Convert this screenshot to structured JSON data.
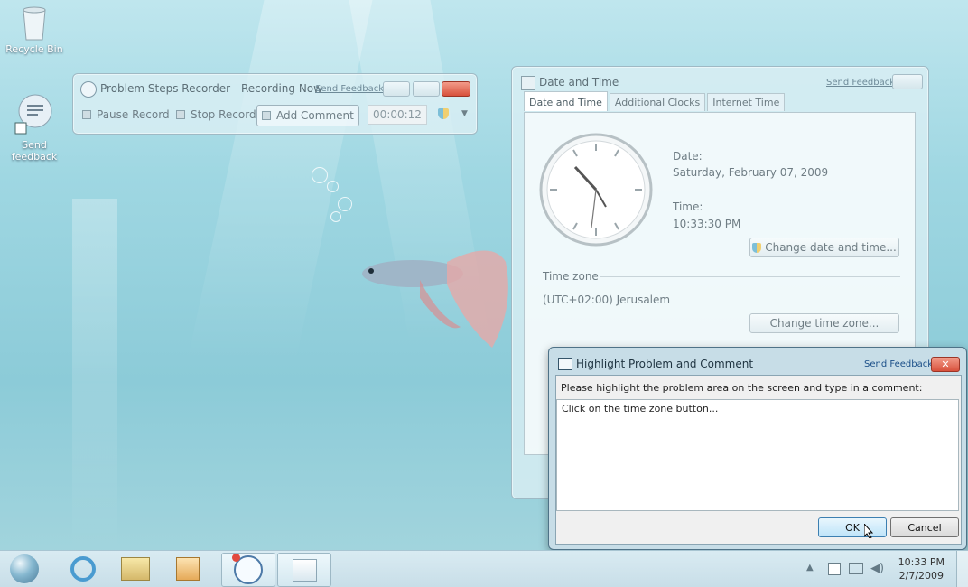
{
  "desktop": {
    "icons": [
      {
        "label": "Recycle Bin",
        "icon": "recycle-bin-icon"
      },
      {
        "label": "Send feedback",
        "icon": "send-feedback-icon"
      }
    ]
  },
  "psr": {
    "title": "Problem Steps Recorder - Recording Now",
    "send_feedback": "Send Feedback",
    "pause": "Pause Record",
    "stop": "Stop Record",
    "add_comment": "Add Comment",
    "timer": "00:00:12"
  },
  "datetime": {
    "title": "Date and Time",
    "send_feedback": "Send Feedback",
    "tabs": [
      "Date and Time",
      "Additional Clocks",
      "Internet Time"
    ],
    "date_label": "Date:",
    "date_value": "Saturday, February 07, 2009",
    "time_label": "Time:",
    "time_value": "10:33:30 PM",
    "change_date_button": "Change date and time...",
    "timezone_header": "Time zone",
    "timezone_value": "(UTC+02:00) Jerusalem",
    "change_timezone_button": "Change time zone..."
  },
  "dialog": {
    "title": "Highlight Problem and Comment",
    "send_feedback": "Send Feedback",
    "prompt": "Please highlight the problem area on the screen and type in a comment:",
    "comment": "Click on the time zone button...",
    "ok": "OK",
    "cancel": "Cancel"
  },
  "taskbar": {
    "time": "10:33 PM",
    "date": "2/7/2009",
    "items": [
      "start-orb-icon",
      "internet-explorer-icon",
      "explorer-icon",
      "media-player-icon",
      "problem-steps-recorder-icon",
      "date-time-icon"
    ]
  }
}
